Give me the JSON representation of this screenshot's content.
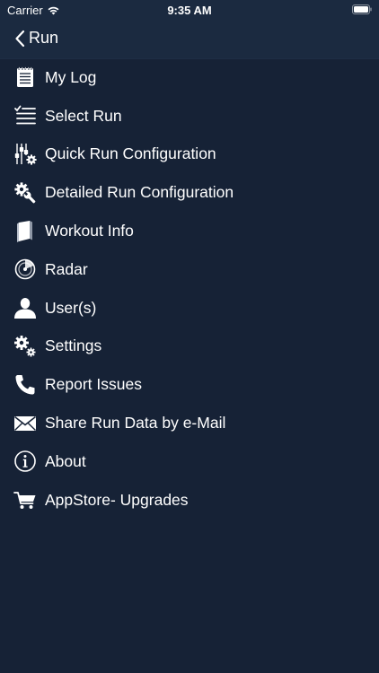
{
  "status_bar": {
    "carrier": "Carrier",
    "time": "9:35 AM"
  },
  "nav": {
    "back_label": "Run"
  },
  "menu": {
    "items": [
      {
        "label": "My Log",
        "icon": "notepad-icon"
      },
      {
        "label": "Select Run",
        "icon": "checklist-icon"
      },
      {
        "label": "Quick Run Configuration",
        "icon": "sliders-gear-icon"
      },
      {
        "label": "Detailed Run Configuration",
        "icon": "gear-wrench-icon"
      },
      {
        "label": "Workout Info",
        "icon": "book-icon"
      },
      {
        "label": "Radar",
        "icon": "radar-icon"
      },
      {
        "label": "User(s)",
        "icon": "user-icon"
      },
      {
        "label": "Settings",
        "icon": "gears-icon"
      },
      {
        "label": "Report Issues",
        "icon": "phone-icon"
      },
      {
        "label": "Share Run Data by e-Mail",
        "icon": "envelope-icon"
      },
      {
        "label": "About",
        "icon": "info-icon"
      },
      {
        "label": "AppStore- Upgrades",
        "icon": "cart-icon"
      }
    ]
  },
  "colors": {
    "background": "#162236",
    "bar_background": "#1b2a40",
    "text": "#ffffff"
  }
}
